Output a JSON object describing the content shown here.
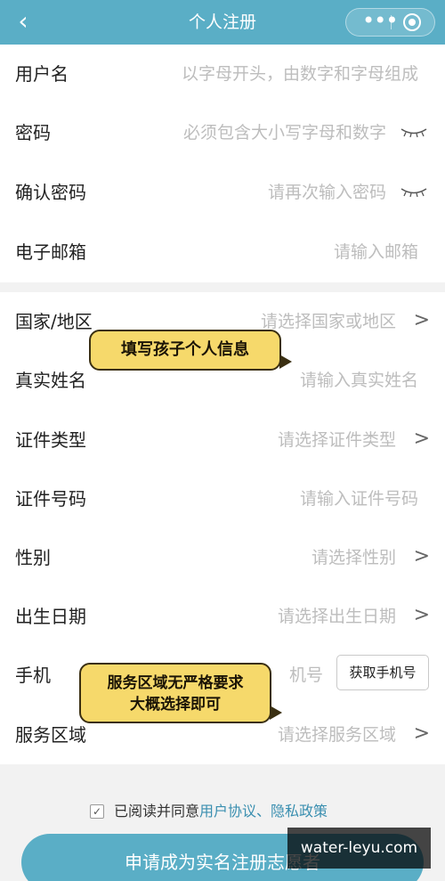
{
  "header": {
    "back_icon": "chevron-left-icon",
    "title": "个人注册"
  },
  "capsule": {
    "more_icon": "dots-icon",
    "close_icon": "target-icon"
  },
  "form": {
    "username": {
      "label": "用户名",
      "placeholder": "以字母开头，由数字和字母组成"
    },
    "password": {
      "label": "密码",
      "placeholder": "必须包含大小写字母和数字"
    },
    "confirm_password": {
      "label": "确认密码",
      "placeholder": "请再次输入密码"
    },
    "email": {
      "label": "电子邮箱",
      "placeholder": "请输入邮箱"
    },
    "country": {
      "label": "国家/地区",
      "placeholder": "请选择国家或地区"
    },
    "real_name": {
      "label": "真实姓名",
      "placeholder": "请输入真实姓名"
    },
    "id_type": {
      "label": "证件类型",
      "placeholder": "请选择证件类型"
    },
    "id_number": {
      "label": "证件号码",
      "placeholder": "请输入证件号码"
    },
    "gender": {
      "label": "性别",
      "placeholder": "请选择性别"
    },
    "birth_date": {
      "label": "出生日期",
      "placeholder": "请选择出生日期"
    },
    "phone": {
      "label": "手机",
      "placeholder_fragment": "机号",
      "button": "获取手机号"
    },
    "service_area": {
      "label": "服务区域",
      "placeholder": "请选择服务区域"
    }
  },
  "annotations": {
    "bubble1": "填写孩子个人信息",
    "bubble2_line1": "服务区域无严格要求",
    "bubble2_line2": "大概选择即可"
  },
  "agreement": {
    "checked": true,
    "check_mark": "✓",
    "prefix": "已阅读并同意",
    "user_agreement": "用户协议",
    "separator": "、",
    "privacy_policy": "隐私政策"
  },
  "submit_label": "申请成为实名注册志愿者",
  "watermark": "water-leyu.com",
  "colors": {
    "header": "#5aaec6",
    "link": "#3a8fb0",
    "bubble": "#f6d96b"
  }
}
